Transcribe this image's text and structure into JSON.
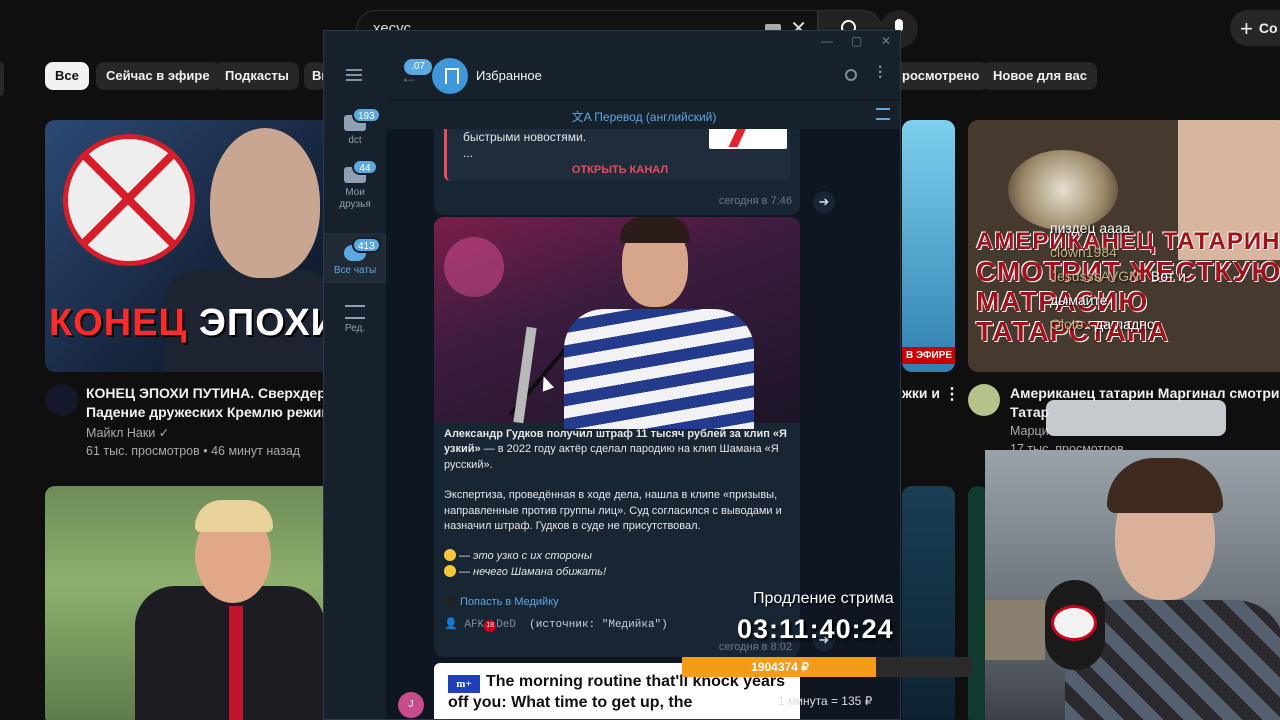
{
  "overlay": {
    "url": "kick.com/jesusavgn"
  },
  "youtube": {
    "search_value": "хесус",
    "create_label": "Со",
    "chips": [
      {
        "label": "Все",
        "active": true
      },
      {
        "label": "Сейчас в эфире"
      },
      {
        "label": "Подкасты"
      },
      {
        "label": "Ви"
      },
      {
        "label": "росмотрено"
      },
      {
        "label": "Новое для вас"
      }
    ],
    "videos": [
      {
        "thumb_text_red": "КОНЕЦ",
        "thumb_text_white": "ЭПОХИ",
        "title_line1": "КОНЕЦ ЭПОХИ ПУТИНА. Сверхдержа",
        "title_line2": "Падение дружеских Кремлю режимо",
        "channel": "Майкл Наки",
        "stats": "61 тыс. просмотров • 46 минут назад"
      },
      {
        "live_badge": "В ЭФИРЕ",
        "title_fragment": "жки и"
      },
      {
        "thumb_lines": [
          "АМЕРИКАНЕЦ ТАТАРИН",
          "СМОТРИТ ЖЕСТКУЮ",
          "МАТРАСИЮ",
          "ТАТАРСТАНА"
        ],
        "title_line1": "Американец татарин Маргинал смотрит м",
        "title_line2": "Татар",
        "channel": "Марци",
        "stats": "17 тыс. просмотров"
      }
    ]
  },
  "stream_chat": [
    {
      "nick": "",
      "text": "пиздец аааа"
    },
    {
      "nick": "clown1984",
      "text": ""
    },
    {
      "nick": "JesusssAVGN",
      "text": ": Вот и"
    },
    {
      "nick": "",
      "text": "дымайте"
    },
    {
      "nick": "Oloto",
      "text": ": да ладно"
    }
  ],
  "stream_widget": {
    "timer_label": "Продление стрима",
    "timer": "03:11:40:24",
    "goal_amount": "1904374 ₽",
    "goal_progress": 0.67,
    "rate": "1 минута = 135 ₽"
  },
  "telegram": {
    "folders": [
      {
        "label": "dct",
        "badge": "193"
      },
      {
        "label": "Мои друзья",
        "badge": "44"
      },
      {
        "label": "Все чаты",
        "badge": "413",
        "active": true
      },
      {
        "label": "Ред."
      }
    ],
    "back_badge": "07",
    "chat_title": "Избранное",
    "translate_label": "Перевод (английский)",
    "messages": {
      "first": {
        "quote_text": "быстрыми новостями.",
        "quote_more": "...",
        "open_channel": "ОТКРЫТЬ КАНАЛ",
        "time": "сегодня в 7:46"
      },
      "second": {
        "para1_bold": "Александр Гудков получил штраф 11 тысяч рублей за клип «Я узкий»",
        "para1_rest": " — в 2022 году актёр сделал пародию на клип Шамана «Я русский».",
        "para2": "Экспертиза, проведённая в ходе дела, нашла в клипе «призывы, направленные против группы лиц». Суд согласился с выводами и назначил штраф. Гудков в суде не присутствовал.",
        "emoji_line1": "— это узко с их стороны",
        "emoji_line2": "— нечего Шамана обижать!",
        "link": "Попасть в Медийку",
        "footer_afk": "AFK",
        "footer_18": "18",
        "footer_ded": "DeD",
        "footer_source": "(источник: \"Медийка\")",
        "time": "сегодня в 8:02"
      },
      "third": {
        "logo": "m+",
        "headline": "The morning routine that'll knock years off you: What time to get up, the"
      }
    },
    "user_initial": "J"
  }
}
